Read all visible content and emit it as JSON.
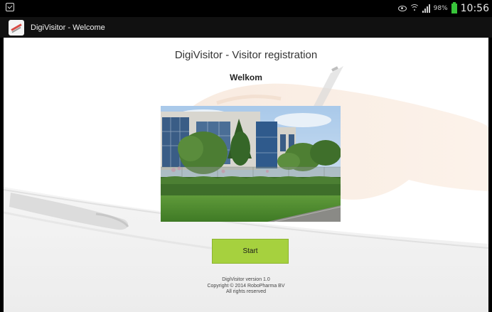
{
  "status_bar": {
    "battery_pct": "98%",
    "time": "10:56",
    "icons": [
      "screenshot-icon",
      "eye-icon",
      "wifi-icon",
      "signal-icon",
      "battery-icon"
    ],
    "battery_color": "#38c43a"
  },
  "action_bar": {
    "title": "DigiVisitor - Welcome",
    "icon": "app-logo-icon"
  },
  "main": {
    "title": "DigiVisitor - Visitor registration",
    "welcome": "Welkom",
    "photo": "building-photo",
    "start_label": "Start",
    "start_color": "#a6d13e"
  },
  "footer": {
    "version": "DigiVisitor version 1.0",
    "copyright": "Copyright © 2014 RoboPharma BV",
    "rights": "All rights reserved"
  }
}
